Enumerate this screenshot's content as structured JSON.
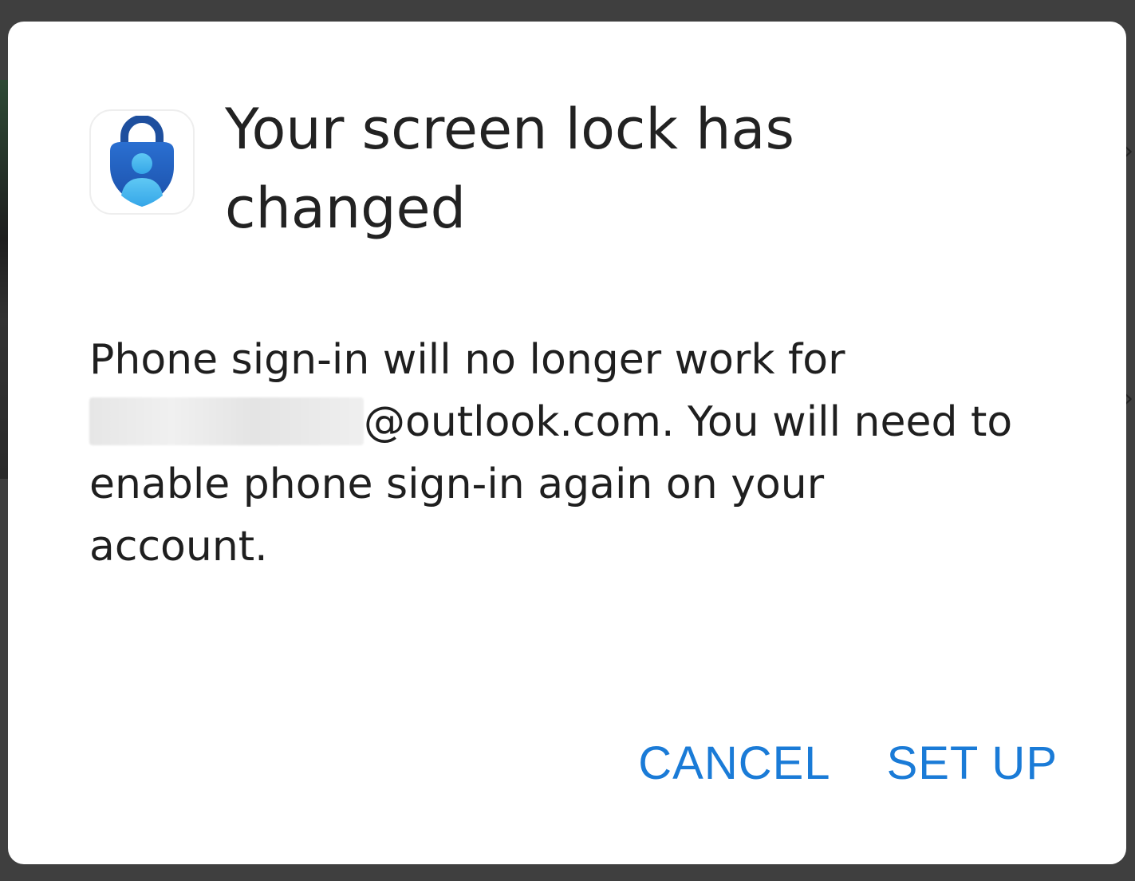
{
  "app_icon": {
    "name": "microsoft-authenticator-icon"
  },
  "dialog": {
    "title": "Your screen lock has changed",
    "message_start": "Phone sign-in will no longer work for",
    "email_domain": "@outlook.com.",
    "message_end": "You will need to enable phone sign-in again on your account.",
    "cancel_label": "CANCEL",
    "setup_label": "SET UP"
  },
  "colors": {
    "accent": "#1a7bd7",
    "dialog_bg": "#ffffff",
    "title_text": "#222222"
  }
}
